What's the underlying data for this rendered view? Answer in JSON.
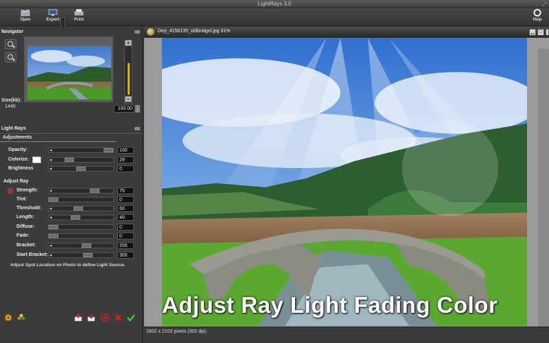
{
  "window": {
    "title": "LightRays 3.0"
  },
  "toolbar": {
    "open_label": "Open",
    "export_label": "Export",
    "print_label": "Print",
    "help_label": "Help"
  },
  "navigator": {
    "title": "Navigator",
    "size_label": "Size(kb):",
    "size_value": "1440",
    "zoom_value": "100.00",
    "zoom_level": 0.5
  },
  "lightrays": {
    "title": "Light Rays",
    "adjustments_tab": "Adjustments",
    "adjustments": [
      {
        "label": "Opacity:",
        "value": "100",
        "level": 1.0
      },
      {
        "label": "Colorize:",
        "value": "29",
        "level": 0.29
      },
      {
        "label": "Brightness",
        "value": "0",
        "level": 0.5
      }
    ],
    "adjust_ray_title": "Adjust Ray",
    "ray": [
      {
        "label": "Strength:",
        "value": "75",
        "level": 0.75
      },
      {
        "label": "Tint:",
        "value": "0",
        "level": 0.0
      },
      {
        "label": "Threshold:",
        "value": "60",
        "level": 0.45
      },
      {
        "label": "Length:",
        "value": "40",
        "level": 0.4
      },
      {
        "label": "Diffuse:",
        "value": "0",
        "level": 0.0
      },
      {
        "label": "Fade:",
        "value": "0",
        "level": 0.0
      },
      {
        "label": "Bracket:",
        "value": "255",
        "level": 0.6
      },
      {
        "label": "Start Bracket:",
        "value": "300",
        "level": 0.62
      }
    ],
    "hint": "Adjust Spot Location on Photo to define Light Source."
  },
  "document": {
    "title": "Dep_4156135_oldbridgel.jpg 31%",
    "caption": "Adjust Ray Light Fading Color",
    "status": "2802 x 2102 pixels (300 dpi)"
  },
  "colors": {
    "accent": "#d7b020",
    "strength_swatch": "#c02020",
    "colorize_swatch": "#ffffff"
  }
}
